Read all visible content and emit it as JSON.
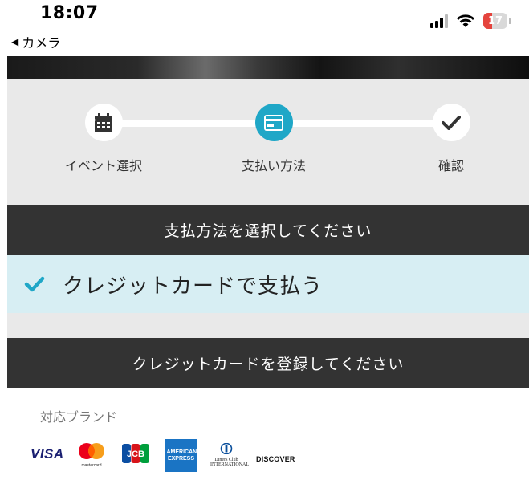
{
  "status_bar": {
    "time": "18:07",
    "back_label": "カメラ",
    "battery_level": "17",
    "battery_color": "#e5443d"
  },
  "stepper": {
    "steps": [
      {
        "label": "イベント選択",
        "icon": "calendar-icon",
        "state": "done"
      },
      {
        "label": "支払い方法",
        "icon": "credit-card-icon",
        "state": "active"
      },
      {
        "label": "確認",
        "icon": "check-icon",
        "state": "pending"
      }
    ],
    "accent_color": "#1fa7c7"
  },
  "payment_section": {
    "header": "支払方法を選択してください",
    "selected_option": "クレジットカードで支払う"
  },
  "card_section": {
    "header": "クレジットカードを登録してください",
    "brands_title": "対応ブランド",
    "brands": [
      {
        "name": "VISA",
        "icon": "visa-logo"
      },
      {
        "name": "mastercard",
        "icon": "mastercard-logo"
      },
      {
        "name": "JCB",
        "icon": "jcb-logo"
      },
      {
        "name": "AMERICAN EXPRESS",
        "icon": "amex-logo"
      },
      {
        "name": "Diners Club INTERNATIONAL",
        "icon": "diners-club-logo"
      },
      {
        "name": "DISCOVER",
        "icon": "discover-logo"
      }
    ]
  }
}
